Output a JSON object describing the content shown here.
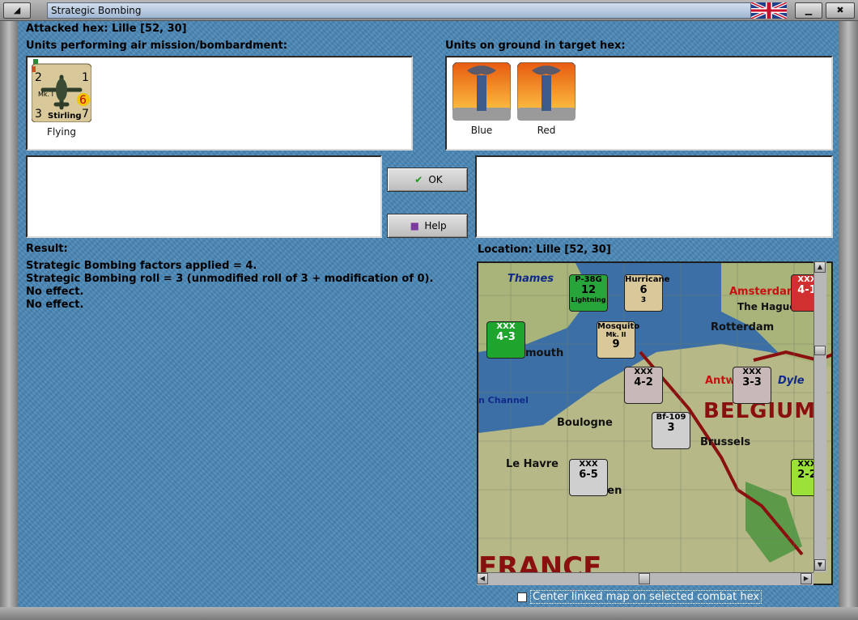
{
  "window": {
    "title": "Strategic Bombing",
    "restore_glyph": "◢",
    "close_glyph": "✖",
    "flag_icon": "uk-flag-icon"
  },
  "header": {
    "attacked_hex": "Attacked hex: Lille  [52, 30]"
  },
  "air_units": {
    "label": "Units performing air mission/bombardment:",
    "items": [
      {
        "name": "Stirling",
        "model": "Mk. I",
        "top_left": "2",
        "top_right": "1",
        "mid_right": "6",
        "bottom_left": "3",
        "bottom_right": "7",
        "status": "Flying"
      }
    ]
  },
  "ground_units": {
    "label": "Units on ground in target hex:",
    "items": [
      {
        "caption": "Blue"
      },
      {
        "caption": "Red"
      }
    ]
  },
  "buttons": {
    "ok": "OK",
    "help": "Help"
  },
  "result": {
    "label": "Result:",
    "lines": [
      "Strategic Bombing factors applied = 4.",
      "Strategic Bombing roll = 3 (unmodified roll of 3 + modification of 0).",
      "No effect.",
      "No effect."
    ]
  },
  "location": {
    "label": "Location:  Lille  [52, 30]"
  },
  "map": {
    "places": [
      "Thames",
      "Amsterdam",
      "The Hague",
      "Rotterdam",
      "mouth",
      "Antw",
      "Dyle",
      "n Channel",
      "Boulogne",
      "BELGIUM",
      "Brussels",
      "Le Havre",
      "uen",
      "FRANCE"
    ],
    "counters": [
      {
        "label": "P-38G",
        "value": "12",
        "sub": "Lightning",
        "color": "#27a53a"
      },
      {
        "label": "Hurricane",
        "value": "6",
        "sub": "3",
        "color": "#d9c89a"
      },
      {
        "label": "Mosquito",
        "value": "9",
        "sub": "Mk. II",
        "color": "#d9c89a"
      },
      {
        "label": "XXX",
        "value": "4-3",
        "sub": "",
        "color": "#1fa52e"
      },
      {
        "label": "XXX",
        "value": "4-2",
        "sub": "",
        "color": "#c8b8b8"
      },
      {
        "label": "XXX",
        "value": "3-3",
        "sub": "",
        "color": "#c8b8b8"
      },
      {
        "label": "Bf-109",
        "value": "3",
        "sub": "",
        "color": "#cfcfcf"
      },
      {
        "label": "XXX",
        "value": "6-5",
        "sub": "",
        "color": "#cfcfcf"
      },
      {
        "label": "XXX",
        "value": "4-1",
        "sub": "",
        "color": "#d03030"
      },
      {
        "label": "XXX",
        "value": "2-2",
        "sub": "",
        "color": "#9ce03a"
      }
    ]
  },
  "center_map_checkbox": {
    "label": "Center linked map on selected combat hex",
    "checked": false
  },
  "colors": {
    "panel_blue": "#4a87b7",
    "title_blue": "#b8cbe2",
    "frame_gray": "#9a9a9a"
  }
}
